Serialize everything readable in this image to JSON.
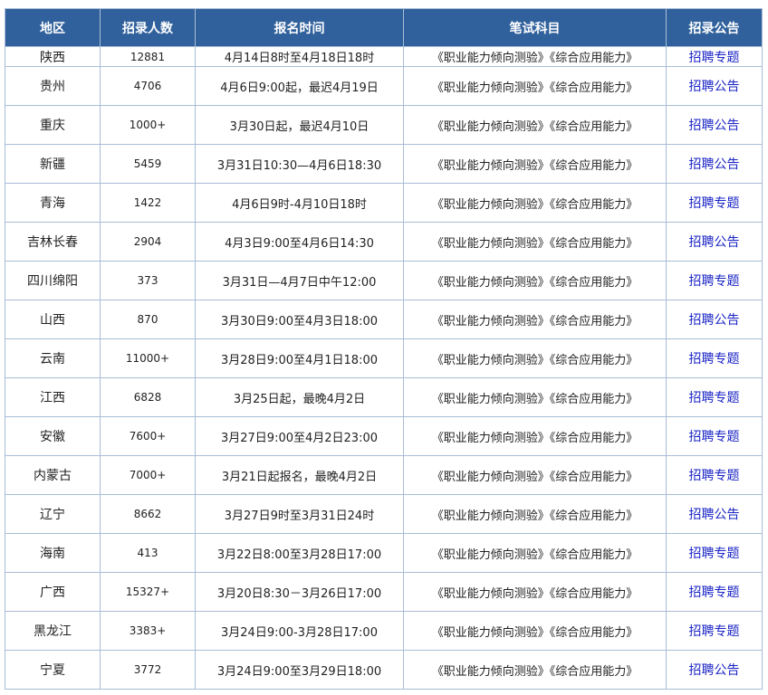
{
  "table": {
    "headers": [
      "地区",
      "招录人数",
      "报名时间",
      "笔试科目",
      "招录公告"
    ],
    "rows": [
      {
        "region": "陕西",
        "count": "12881",
        "time": "4月14日8时至4月18日18时",
        "subject": "《职业能力倾向测验》《综合应用能力》",
        "link": "招聘专题"
      },
      {
        "region": "贵州",
        "count": "4706",
        "time": "4月6日9:00起，最迟4月19日",
        "subject": "《职业能力倾向测验》《综合应用能力》",
        "link": "招聘公告"
      },
      {
        "region": "重庆",
        "count": "1000+",
        "time": "3月30日起，最迟4月10日",
        "subject": "《职业能力倾向测验》《综合应用能力》",
        "link": "招聘公告"
      },
      {
        "region": "新疆",
        "count": "5459",
        "time": "3月31日10:30—4月6日18:30",
        "subject": "《职业能力倾向测验》《综合应用能力》",
        "link": "招聘公告"
      },
      {
        "region": "青海",
        "count": "1422",
        "time": "4月6日9时-4月10日18时",
        "subject": "《职业能力倾向测验》《综合应用能力》",
        "link": "招聘专题"
      },
      {
        "region": "吉林长春",
        "count": "2904",
        "time": "4月3日9:00至4月6日14:30",
        "subject": "《职业能力倾向测验》《综合应用能力》",
        "link": "招聘公告"
      },
      {
        "region": "四川绵阳",
        "count": "373",
        "time": "3月31日—4月7日中午12:00",
        "subject": "《职业能力倾向测验》《综合应用能力》",
        "link": "招聘专题"
      },
      {
        "region": "山西",
        "count": "870",
        "time": "3月30日9:00至4月3日18:00",
        "subject": "《职业能力倾向测验》《综合应用能力》",
        "link": "招聘公告"
      },
      {
        "region": "云南",
        "count": "11000+",
        "time": "3月28日9:00至4月1日18:00",
        "subject": "《职业能力倾向测验》《综合应用能力》",
        "link": "招聘专题"
      },
      {
        "region": "江西",
        "count": "6828",
        "time": "3月25日起，最晚4月2日",
        "subject": "《职业能力倾向测验》《综合应用能力》",
        "link": "招聘专题"
      },
      {
        "region": "安徽",
        "count": "7600+",
        "time": "3月27日9:00至4月2日23:00",
        "subject": "《职业能力倾向测验》《综合应用能力》",
        "link": "招聘专题"
      },
      {
        "region": "内蒙古",
        "count": "7000+",
        "time": "3月21日起报名，最晚4月2日",
        "subject": "《职业能力倾向测验》《综合应用能力》",
        "link": "招聘专题"
      },
      {
        "region": "辽宁",
        "count": "8662",
        "time": "3月27日9时至3月31日24时",
        "subject": "《职业能力倾向测验》《综合应用能力》",
        "link": "招聘公告"
      },
      {
        "region": "海南",
        "count": "413",
        "time": "3月22日8:00至3月28日17:00",
        "subject": "《职业能力倾向测验》《综合应用能力》",
        "link": "招聘专题"
      },
      {
        "region": "广西",
        "count": "15327+",
        "time": "3月20日8:30－3月26日17:00",
        "subject": "《职业能力倾向测验》《综合应用能力》",
        "link": "招聘专题"
      },
      {
        "region": "黑龙江",
        "count": "3383+",
        "time": "3月24日9:00-3月28日17:00",
        "subject": "《职业能力倾向测验》《综合应用能力》",
        "link": "招聘专题"
      },
      {
        "region": "宁夏",
        "count": "3772",
        "time": "3月24日9:00至3月29日18:00",
        "subject": "《职业能力倾向测验》《综合应用能力》",
        "link": "招聘公告"
      }
    ]
  }
}
